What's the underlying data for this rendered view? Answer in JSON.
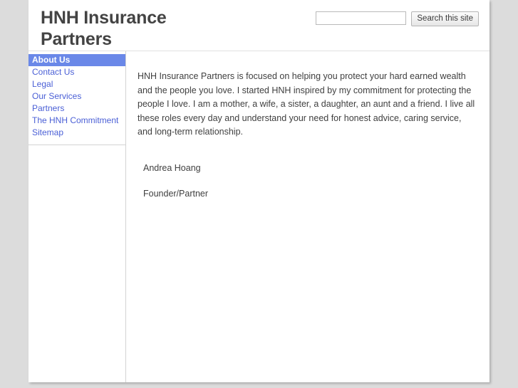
{
  "header": {
    "site_title": "HNH Insurance Partners",
    "search": {
      "input_value": "",
      "placeholder": "",
      "button_label": "Search this site"
    }
  },
  "sidebar": {
    "items": [
      {
        "label": "About Us",
        "active": true
      },
      {
        "label": "Contact Us",
        "active": false
      },
      {
        "label": "Legal",
        "active": false
      },
      {
        "label": "Our Services",
        "active": false
      },
      {
        "label": "Partners",
        "active": false
      },
      {
        "label": "The HNH Commitment",
        "active": false
      },
      {
        "label": "Sitemap",
        "active": false
      }
    ]
  },
  "main": {
    "intro_paragraph": "HNH Insurance Partners is focused on helping you protect your hard earned wealth and the people you love.  I started HNH inspired by my commitment for protecting the people I love.  I am a mother, a wife, a sister, a daughter, an aunt and a friend.  I live all these roles every day and understand your need for honest advice, caring service, and long-term relationship.",
    "signature_name": "Andrea Hoang",
    "signature_role": "Founder/Partner"
  },
  "colors": {
    "page_background": "#dcdcdc",
    "content_background": "#ffffff",
    "link": "#4a5fd6",
    "active_nav_background": "#6a88e8",
    "active_nav_text": "#ffffff",
    "title_text": "#434343",
    "body_text": "#3f3f3f"
  }
}
